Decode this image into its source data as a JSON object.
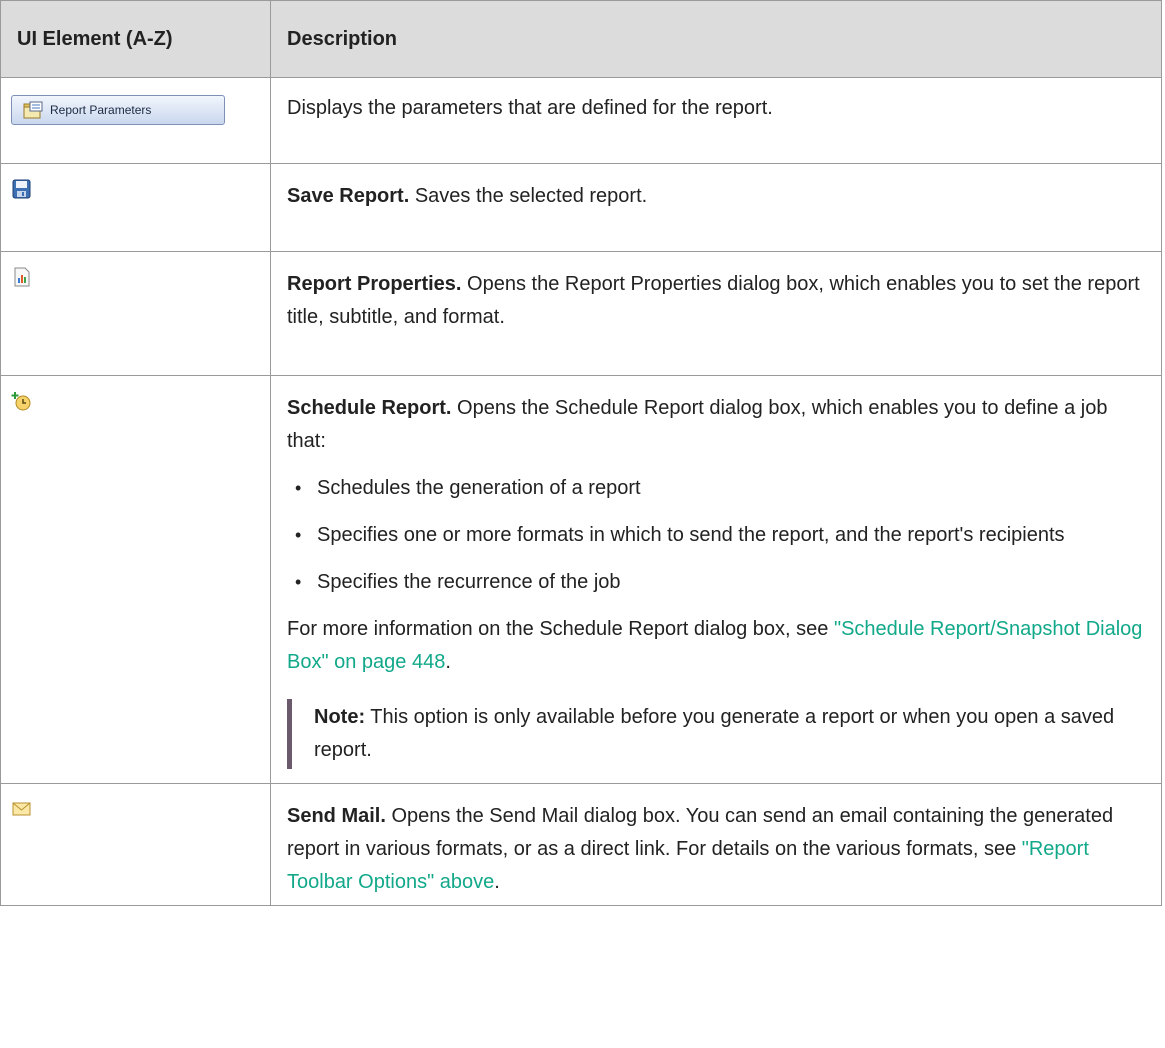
{
  "header": {
    "col1": "UI Element (A-Z)",
    "col2": "Description"
  },
  "rows": {
    "params": {
      "button_label": "Report Parameters",
      "desc": "Displays the parameters that are defined for the report."
    },
    "save": {
      "title": "Save Report.",
      "desc": " Saves the selected report."
    },
    "props": {
      "title": "Report Properties.",
      "desc": " Opens the Report Properties dialog box, which enables you to set the report title, subtitle, and format."
    },
    "schedule": {
      "title": "Schedule Report.",
      "desc": " Opens the Schedule Report dialog box, which enables you to define a job that:",
      "bullets": [
        "Schedules the generation of a report",
        "Specifies one or more formats in which to send the report, and the report's recipients",
        "Specifies the recurrence of the job"
      ],
      "more_prefix": "For more information on the Schedule Report dialog box, see ",
      "more_link": "\"Schedule Report/Snapshot Dialog Box\" on page 448",
      "more_suffix": ".",
      "note_label": "Note:",
      "note_text": " This option is only available before you generate a report or when you open a saved report."
    },
    "mail": {
      "title": "Send Mail.",
      "desc": " Opens the Send Mail dialog box. You can send an email containing the generated report in various formats, or as a direct link. For details on the various formats, see ",
      "link": "\"Report Toolbar Options\" above",
      "suffix": "."
    }
  },
  "icons": {
    "params": "report-parameters-icon",
    "save": "save-disk-icon",
    "props": "report-properties-icon",
    "schedule": "schedule-clock-icon",
    "mail": "mail-envelope-icon"
  },
  "colors": {
    "link": "#12a88a",
    "header_bg": "#dcdcdc",
    "note_bar": "#6b5a6b"
  }
}
